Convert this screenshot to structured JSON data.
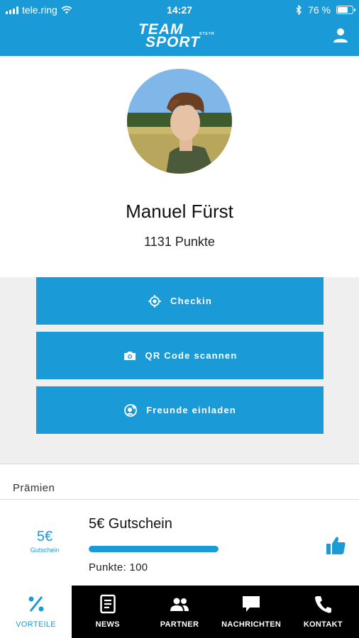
{
  "status": {
    "carrier": "tele.ring",
    "time": "14:27",
    "battery": "76 %",
    "battery_level": 0.76
  },
  "header": {
    "logo_line1": "TEAM",
    "logo_line2": "SPORT",
    "logo_tag": "STEYR",
    "user_icon": "user-icon"
  },
  "profile": {
    "name": "Manuel Fürst",
    "points": "1131 Punkte"
  },
  "actions": [
    {
      "label": "Checkin",
      "icon": "target-icon"
    },
    {
      "label": "QR Code scannen",
      "icon": "camera-icon"
    },
    {
      "label": "Freunde einladen",
      "icon": "add-friend-icon"
    }
  ],
  "rewards": {
    "title": "Prämien",
    "items": [
      {
        "badge_amount": "5€",
        "badge_sub": "Gutschein",
        "name": "5€ Gutschein",
        "points_label": "Punkte: 100",
        "progress": 1.0,
        "icon": "thumbs-up-icon"
      }
    ]
  },
  "tabs": [
    {
      "label": "VORTEILE",
      "icon": "percent-icon",
      "active": true
    },
    {
      "label": "NEWS",
      "icon": "document-icon",
      "active": false
    },
    {
      "label": "PARTNER",
      "icon": "people-icon",
      "active": false
    },
    {
      "label": "NACHRICHTEN",
      "icon": "chat-icon",
      "active": false
    },
    {
      "label": "KONTAKT",
      "icon": "phone-icon",
      "active": false
    }
  ],
  "colors": {
    "accent": "#1a9bd7",
    "tabbar": "#000000",
    "section_bg": "#efefef"
  }
}
